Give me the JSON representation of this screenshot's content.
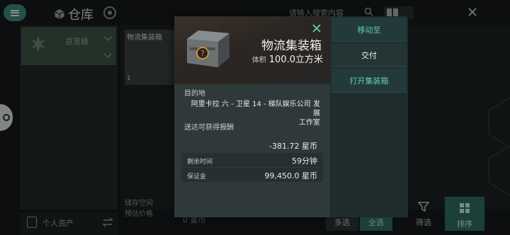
{
  "app": {
    "title": "仓库"
  },
  "search": {
    "placeholder": "请输入搜索内容"
  },
  "sidebar": {
    "folder_label": "总览级",
    "wallet_label": "个人资产"
  },
  "grid": {
    "card_title": "物流集装箱",
    "card_count": "1"
  },
  "footer": {
    "storage_label": "储存空间",
    "value_label": "预估价格",
    "value": "0 星币",
    "multi_select": "多选",
    "select_all": "全选",
    "filter": "筛选",
    "sort": "排序"
  },
  "modal": {
    "item_name": "物流集装箱",
    "volume_label": "体积",
    "volume_value": "100.0立方米",
    "destination_label": "目的地",
    "destination_line1": "阿里卡拉 六 - 卫星 14 - 梯队娱乐公司 发展",
    "destination_line2": "工作室",
    "reward_label": "送达可获得报酬",
    "reward_value": "-381.72 星币",
    "time_label": "剩余时间",
    "time_value": "59分钟",
    "deposit_label": "保证金",
    "deposit_value": "99,450.0 星币"
  },
  "actions": {
    "move": "移动至",
    "deliver": "交付",
    "open": "打开集装箱"
  },
  "colors": {
    "accent": "#62cdb6",
    "brand_green": "#3f8a7d",
    "modal_bg": "#30393a"
  },
  "icons": [
    "menu-icon",
    "cube-icon",
    "target-icon",
    "search-icon",
    "grid-view-icon",
    "close-icon",
    "crate-icon",
    "wallet-icon",
    "swap-icon",
    "filter-icon",
    "sort-icon"
  ]
}
